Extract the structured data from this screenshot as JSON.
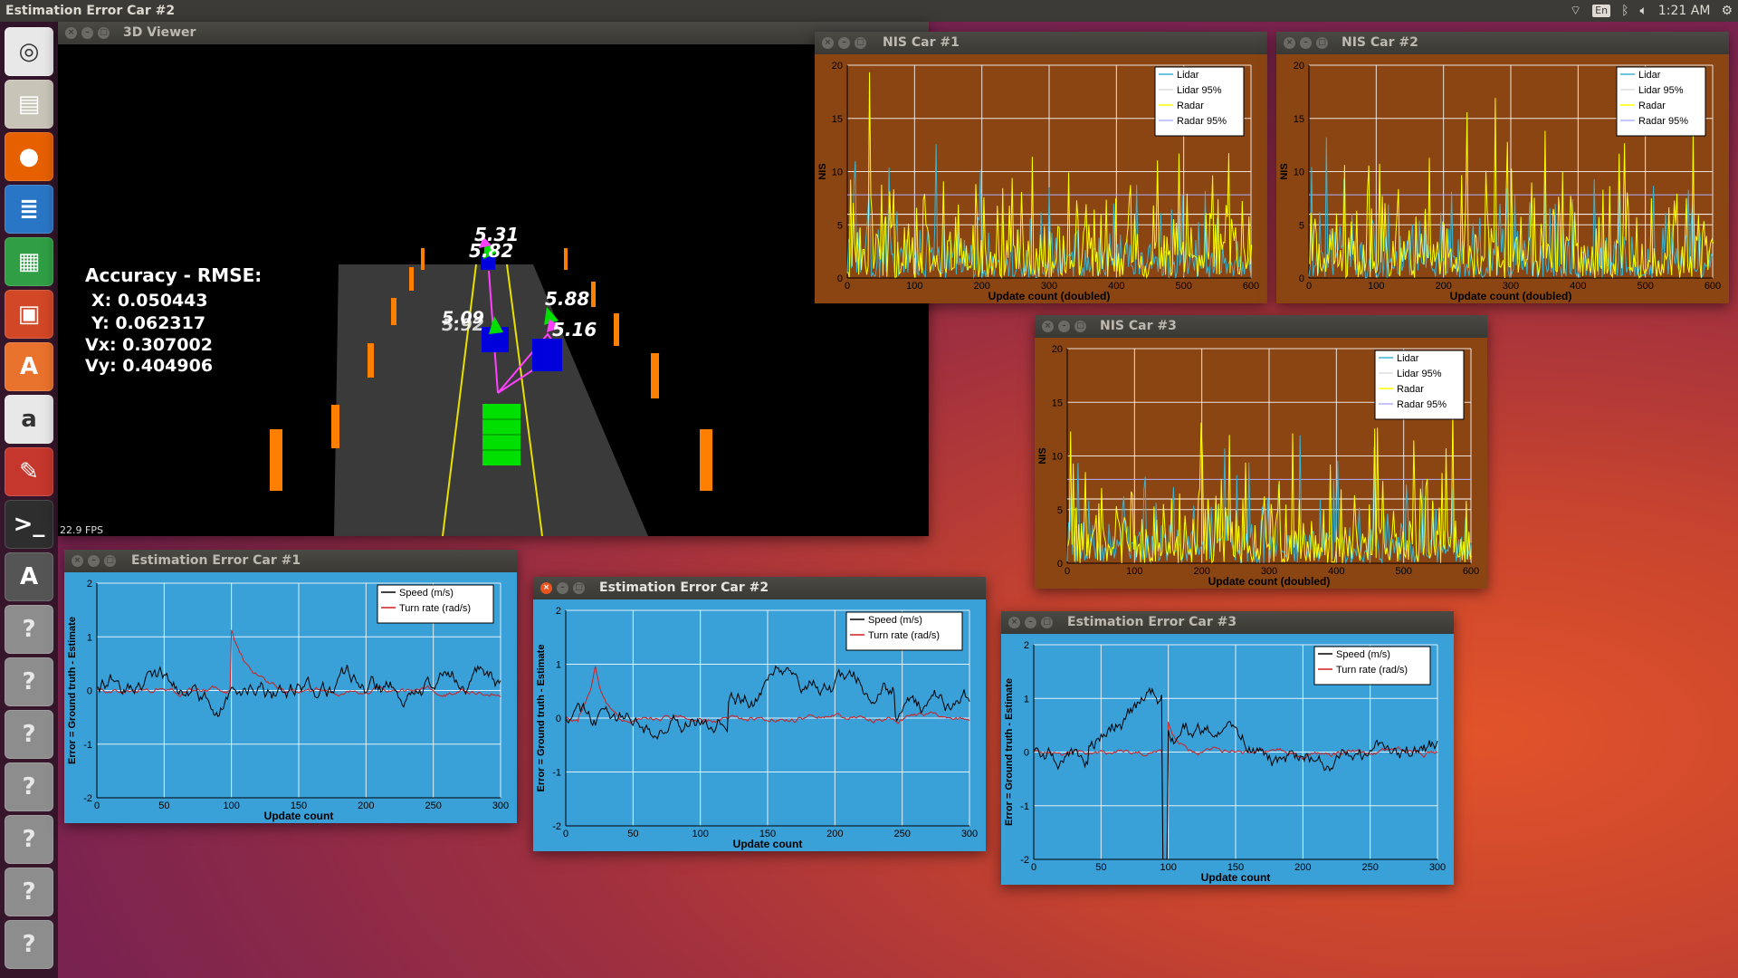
{
  "topbar": {
    "title": "Estimation Error Car #2",
    "keyboard": "En",
    "time": "1:21 AM"
  },
  "launcher": {
    "items": [
      {
        "icon": "ubuntu-dash-icon",
        "glyph": "◎",
        "color": "#e8e8e8"
      },
      {
        "icon": "files-icon",
        "glyph": "▤",
        "color": "#c9c4b8"
      },
      {
        "icon": "firefox-icon",
        "glyph": "●",
        "color": "#e66000"
      },
      {
        "icon": "writer-icon",
        "glyph": "≣",
        "color": "#2a76c6"
      },
      {
        "icon": "calc-icon",
        "glyph": "▦",
        "color": "#2f9e44"
      },
      {
        "icon": "impress-icon",
        "glyph": "▣",
        "color": "#d24726"
      },
      {
        "icon": "software-center-icon",
        "glyph": "A",
        "color": "#e9722c"
      },
      {
        "icon": "amazon-icon",
        "glyph": "a",
        "color": "#e8e8e8"
      },
      {
        "icon": "settings-icon",
        "glyph": "✎",
        "color": "#c5362c"
      },
      {
        "icon": "terminal-icon",
        "glyph": ">_",
        "color": "#2e2e2e"
      },
      {
        "icon": "updater-icon",
        "glyph": "A",
        "color": "#555"
      },
      {
        "icon": "unknown-app-icon",
        "glyph": "?",
        "color": "#8d8d8d"
      },
      {
        "icon": "unknown-app-icon",
        "glyph": "?",
        "color": "#8d8d8d"
      },
      {
        "icon": "unknown-app-icon",
        "glyph": "?",
        "color": "#8d8d8d"
      },
      {
        "icon": "unknown-app-icon",
        "glyph": "?",
        "color": "#8d8d8d"
      },
      {
        "icon": "unknown-app-icon",
        "glyph": "?",
        "color": "#8d8d8d"
      },
      {
        "icon": "unknown-app-icon",
        "glyph": "?",
        "color": "#8d8d8d"
      },
      {
        "icon": "unknown-app-icon",
        "glyph": "?",
        "color": "#8d8d8d"
      }
    ]
  },
  "viewer": {
    "title": "3D Viewer",
    "rmse_title": "Accuracy - RMSE:",
    "rmse_x": "X: 0.050443",
    "rmse_y": "Y: 0.062317",
    "rmse_vx": "Vx: 0.307002",
    "rmse_vy": "Vy: 0.404906",
    "fps": "22.9 FPS",
    "markers": [
      "5.31",
      "5.82",
      "5.88",
      "5.16",
      "5.09",
      "5.92"
    ]
  },
  "windows": {
    "nis1": {
      "title": "NIS Car #1"
    },
    "nis2": {
      "title": "NIS Car #2"
    },
    "nis3": {
      "title": "NIS Car #3"
    },
    "err1": {
      "title": "Estimation Error Car #1"
    },
    "err2": {
      "title": "Estimation Error Car #2"
    },
    "err3": {
      "title": "Estimation Error Car #3"
    }
  },
  "nis_chart": {
    "type": "line",
    "xlabel": "Update count (doubled)",
    "ylabel": "NIS",
    "xlim": [
      0,
      600
    ],
    "ylim": [
      0,
      20
    ],
    "xticks": [
      0,
      100,
      200,
      300,
      400,
      500,
      600
    ],
    "yticks": [
      0,
      5,
      10,
      15,
      20
    ],
    "legend": [
      "Lidar",
      "Lidar 95%",
      "Radar",
      "Radar 95%"
    ],
    "thresholds": {
      "lidar95": 5.99,
      "radar95": 7.82
    },
    "colors": {
      "bg": "#8b4513",
      "lidar": "#3cb4d0",
      "lidar95": "#ffffff",
      "radar": "#ffff00",
      "radar95": "#b0b0ff"
    },
    "grid": true,
    "legend_placement": "top-right"
  },
  "err_chart": {
    "type": "line",
    "xlabel": "Update count",
    "ylabel": "Error = Ground truth - Estimate",
    "xlim": [
      0,
      300
    ],
    "ylim": [
      -2,
      2
    ],
    "xticks": [
      0,
      50,
      100,
      150,
      200,
      250,
      300
    ],
    "yticks": [
      -2,
      -1,
      0,
      1,
      2
    ],
    "legend": [
      "Speed (m/s)",
      "Turn rate (rad/s)"
    ],
    "colors": {
      "bg": "#3aa0d8",
      "speed": "#000000",
      "turn": "#d02020"
    },
    "grid": true,
    "legend_placement": "top-right"
  }
}
